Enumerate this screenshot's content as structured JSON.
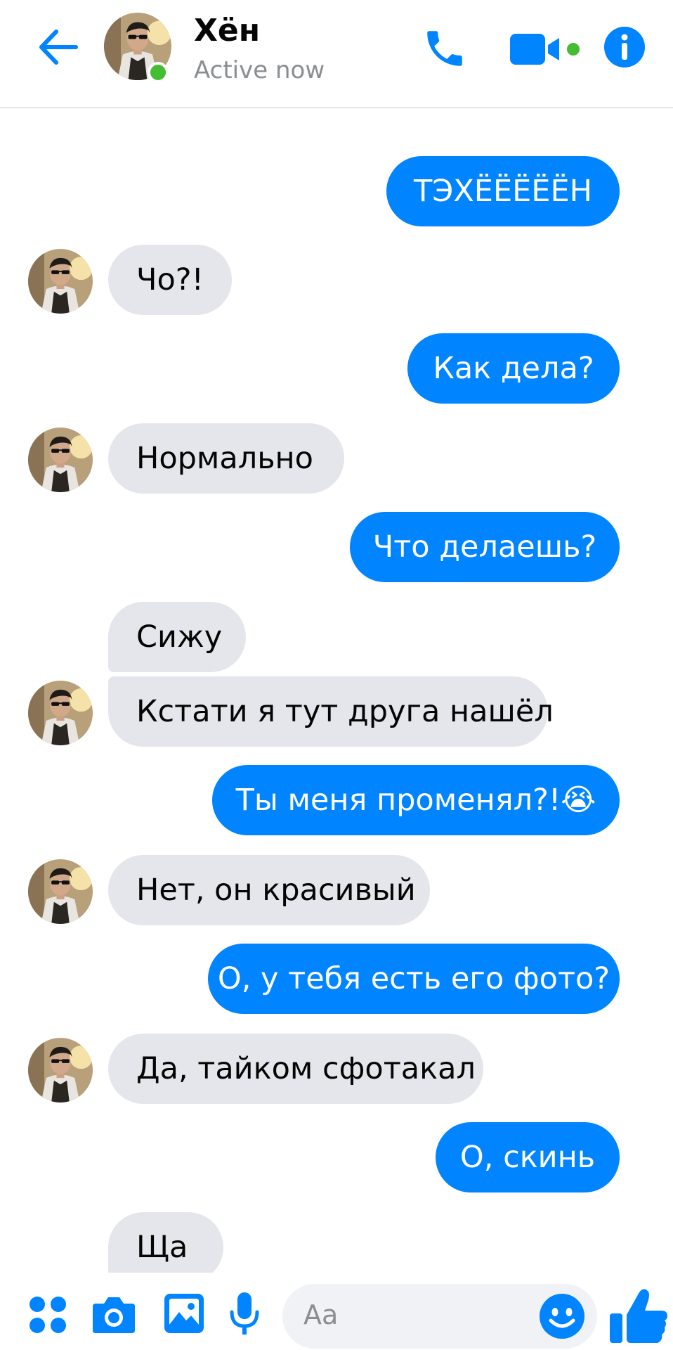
{
  "header": {
    "contact_name": "Хён",
    "status": "Active now",
    "online_color": "#44bd32",
    "accent_color": "#0084ff"
  },
  "messages": [
    {
      "side": "out",
      "text": "ТЭХЁЁЁЁЁН"
    },
    {
      "side": "in",
      "text": "Чо?!",
      "avatar": true
    },
    {
      "side": "out",
      "text": "Как дела?"
    },
    {
      "side": "in",
      "text": "Нормально",
      "avatar": true
    },
    {
      "side": "out",
      "text": "Что делаешь?"
    },
    {
      "side": "in",
      "text": "Сижу",
      "avatar": false
    },
    {
      "side": "in",
      "text": "Кстати я тут друга нашёл",
      "avatar": true
    },
    {
      "side": "out",
      "text": "Ты меня променял?!😭"
    },
    {
      "side": "in",
      "text": "Нет, он красивый",
      "avatar": true
    },
    {
      "side": "out",
      "text": "О, у тебя есть его фото?"
    },
    {
      "side": "in",
      "text": "Да, тайком сфотакал",
      "avatar": true
    },
    {
      "side": "out",
      "text": "О, скинь"
    },
    {
      "side": "in",
      "text": "Ща",
      "avatar": false
    }
  ],
  "composer": {
    "placeholder": "Aa"
  },
  "icons": {
    "back": "back-arrow-icon",
    "call": "phone-icon",
    "video": "video-camera-icon",
    "info": "info-icon",
    "menu": "four-dots-icon",
    "camera": "camera-icon",
    "gallery": "image-icon",
    "voice": "microphone-icon",
    "emoji": "emoji-icon",
    "like": "thumbs-up-icon"
  }
}
